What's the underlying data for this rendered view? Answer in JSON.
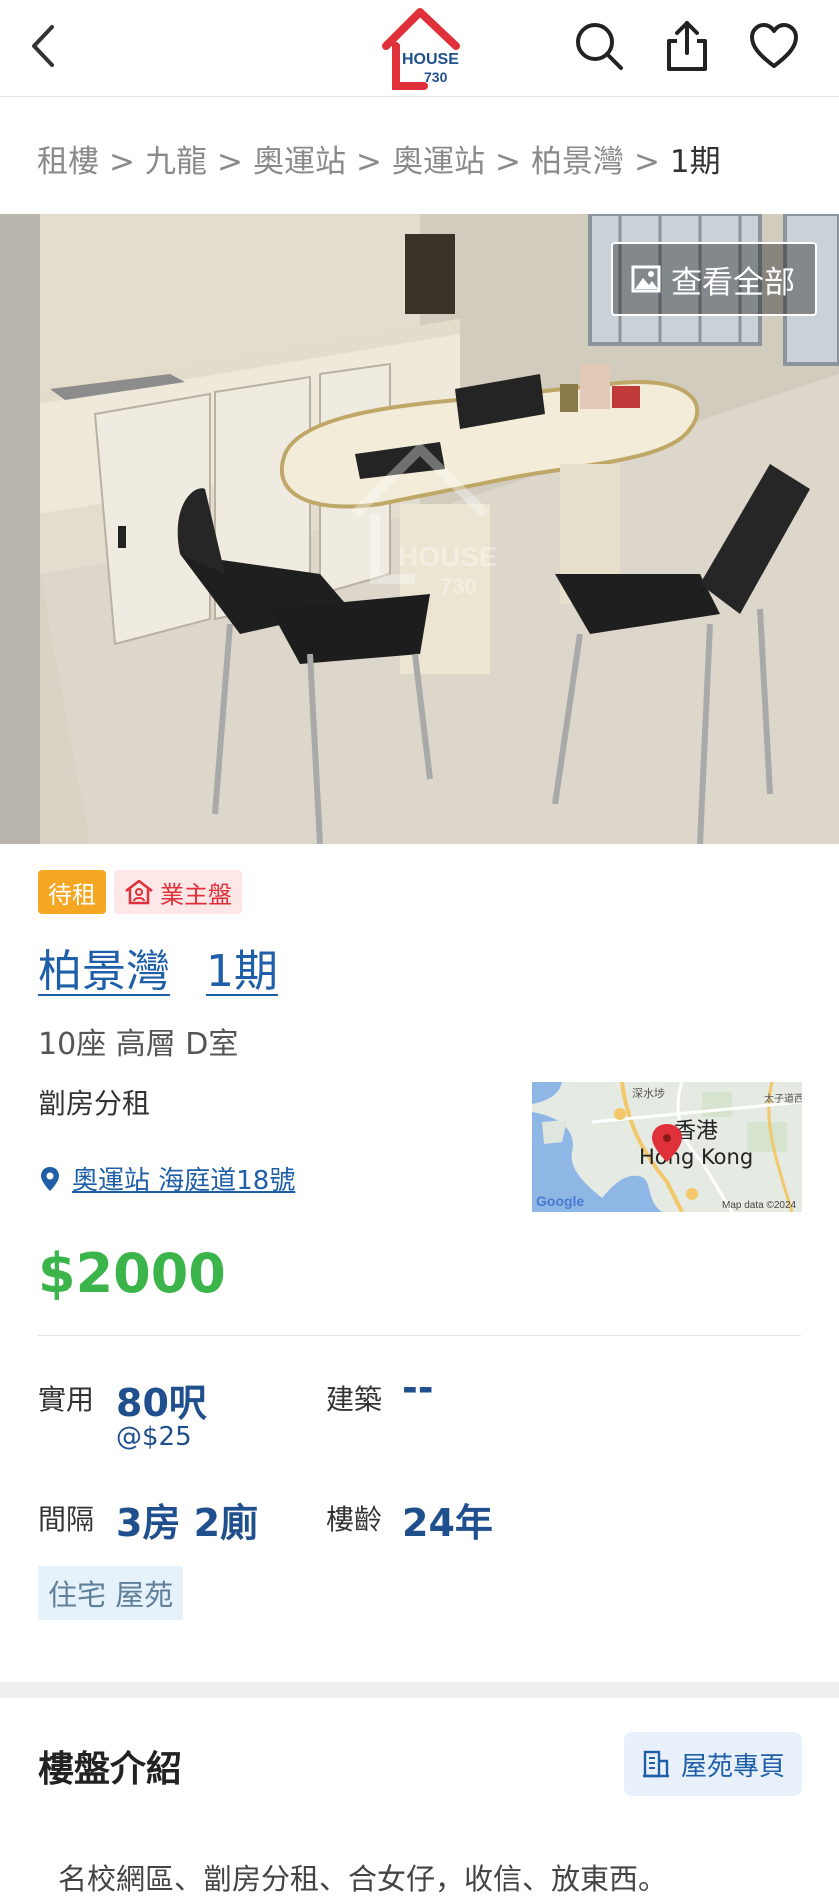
{
  "header": {
    "logo_text": "HOUSE",
    "logo_number": "730",
    "back_icon": "chevron-left-icon",
    "search_icon": "search-icon",
    "share_icon": "share-icon",
    "favorite_icon": "heart-icon"
  },
  "breadcrumb": [
    "租樓",
    "九龍",
    "奧運站",
    "奧運站",
    "柏景灣",
    "1期"
  ],
  "breadcrumb_separator": ">",
  "photo": {
    "view_all_label": "查看全部",
    "watermark_text": "HOUSE",
    "watermark_number": "730"
  },
  "tags": {
    "status": "待租",
    "owner": "業主盤"
  },
  "listing": {
    "estate": "柏景灣",
    "phase": "1期",
    "unit": "10座 高層 D室",
    "subtype": "劏房分租",
    "address": "奧運站 海庭道18號",
    "price": "$2000"
  },
  "map": {
    "label_zh": "香港",
    "label_en": "Hong Kong",
    "label_north": "深水埗",
    "label_ne": "太子道西",
    "google": "Google",
    "attribution": "Map data ©2024"
  },
  "specs": {
    "saleable_label": "實用",
    "saleable_value": "80呎",
    "saleable_unit_price": "@$25",
    "gross_label": "建築",
    "gross_value": "--",
    "layout_label": "間隔",
    "layout_value": "3房 2廁",
    "age_label": "樓齡",
    "age_value": "24年"
  },
  "property_type": "住宅 屋苑",
  "intro": {
    "title": "樓盤介紹",
    "estate_page_button": "屋苑專頁",
    "description": "名校網區、劏房分租、合女仔，收信、放東西。"
  },
  "colors": {
    "brand_red": "#e0303a",
    "link_blue": "#1f5fa8",
    "value_navy": "#1f4f8c",
    "price_green": "#3bb54a",
    "status_orange": "#f5a623"
  }
}
